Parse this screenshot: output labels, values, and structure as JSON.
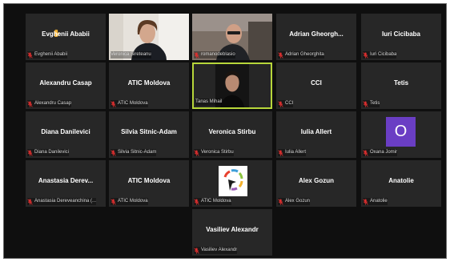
{
  "meeting": {
    "participants": [
      {
        "display": "Evghenii Ababii",
        "label": "Evghenii Ababii"
      },
      {
        "display": "",
        "label": "Veronica Sireteanu"
      },
      {
        "display": "",
        "label": "romanodeblasio"
      },
      {
        "display": "Adrian Gheorgh...",
        "label": "Adrian Gheorghita"
      },
      {
        "display": "Iuri Cicibaba",
        "label": "Iuri Cicibaba"
      },
      {
        "display": "Alexandru Casap",
        "label": "Alexandru Casap"
      },
      {
        "display": "ATIC Moldova",
        "label": "ATIC Moldova"
      },
      {
        "display": "",
        "label": "Tanas Mihail"
      },
      {
        "display": "CCI",
        "label": "CCI"
      },
      {
        "display": "Tetis",
        "label": "Tetis"
      },
      {
        "display": "Diana Danilevici",
        "label": "Diana Danilevici"
      },
      {
        "display": "Silvia Sitnic-Adam",
        "label": "Silvia Sitnic-Adam"
      },
      {
        "display": "Veronica Stirbu",
        "label": "Veronica Stirbu"
      },
      {
        "display": "Iulia Allert",
        "label": "Iulia Allert"
      },
      {
        "display": "",
        "label": "Oxana Jomir",
        "avatar_letter": "O"
      },
      {
        "display": "Anastasia Derev...",
        "label": "Anastasia Dereveanchina (..."
      },
      {
        "display": "ATIC Moldova",
        "label": "ATIC Moldova"
      },
      {
        "display": "",
        "label": "ATIC Moldova"
      },
      {
        "display": "Alex Gozun",
        "label": "Alex Gozun"
      },
      {
        "display": "Anatolie",
        "label": "Anatolie"
      },
      {
        "display": "Vasiliev Alexandr",
        "label": "Vasiliev Alexandr"
      }
    ]
  },
  "colors": {
    "muted_icon": "#e02f2f",
    "active_speaker_border": "#b7d63a",
    "avatar_bg": "#6a3ec4",
    "raised_hand": "#f5b335"
  },
  "icons": [
    "hand-raised-icon",
    "muted-mic-icon"
  ]
}
